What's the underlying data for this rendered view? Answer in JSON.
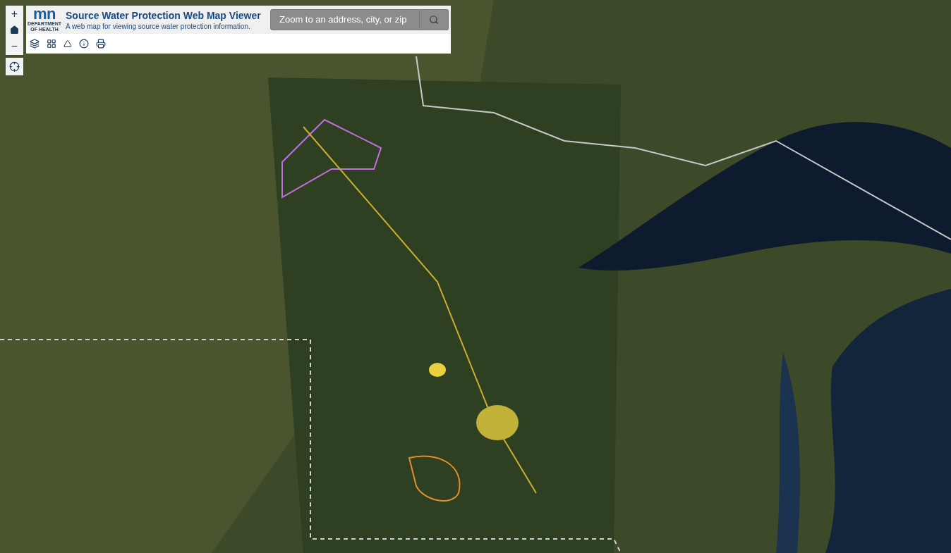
{
  "zoom_controls": {
    "zoom_in": "+",
    "zoom_out": "−"
  },
  "header": {
    "logo": {
      "mark": "mn",
      "line_1": "DEPARTMENT",
      "line_2": "OF HEALTH"
    },
    "title": "Source Water Protection Web Map Viewer",
    "subtitle": "A web map for viewing source water protection information.",
    "search": {
      "placeholder": "Zoom to an address, city, or zip"
    }
  }
}
